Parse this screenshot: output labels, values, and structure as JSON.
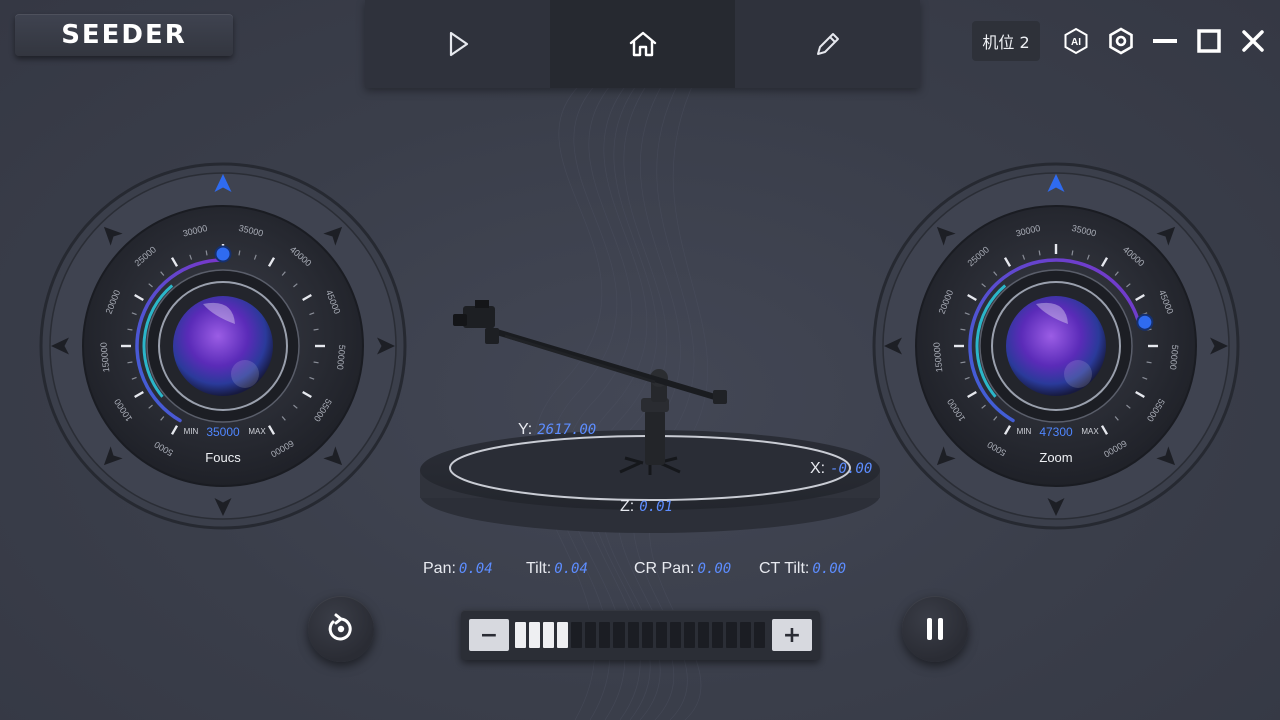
{
  "app": {
    "logo": "SEEDER"
  },
  "nav": {
    "tabs": [
      {
        "name": "play-icon"
      },
      {
        "name": "home-icon"
      },
      {
        "name": "edit-icon"
      }
    ],
    "active": 1
  },
  "window": {
    "station_label": "机位 2",
    "ai_label": "AI",
    "icons": [
      "ai-icon",
      "gear-icon",
      "minimize-icon",
      "maximize-icon",
      "close-icon"
    ]
  },
  "focus_dial": {
    "label": "Foucs",
    "value": "35000",
    "min_label": "MIN",
    "max_label": "MAX",
    "ticks": [
      "5000",
      "10000",
      "150000",
      "20000",
      "25000",
      "30000",
      "35000",
      "40000",
      "45000",
      "50000",
      "55000",
      "60000"
    ],
    "level": 0.5
  },
  "zoom_dial": {
    "label": "Zoom",
    "value": "47300",
    "min_label": "MIN",
    "max_label": "MAX",
    "ticks": [
      "5000",
      "10000",
      "150000",
      "20000",
      "25000",
      "30000",
      "35000",
      "40000",
      "45000",
      "50000",
      "55000",
      "60000"
    ],
    "level": 0.75
  },
  "coords": {
    "y_label": "Y:",
    "y_value": "2617.00",
    "x_label": "X:",
    "x_value": "-0.00",
    "z_label": "Z:",
    "z_value": "0.01"
  },
  "readouts": {
    "pan_label": "Pan:",
    "pan_value": "0.04",
    "tilt_label": "Tilt:",
    "tilt_value": "0.04",
    "crpan_label": "CR Pan:",
    "crpan_value": "0.00",
    "cttilt_label": "CT Tilt:",
    "cttilt_value": "0.00"
  },
  "speed": {
    "minus_label": "−",
    "plus_label": "+",
    "segments": 18,
    "active_segments": 4
  },
  "controls": {
    "left_button": "reset-icon",
    "right_button": "pause-icon"
  },
  "colors": {
    "accent": "#3f7bff",
    "value_blue": "#5d8dff",
    "teal": "#2bb6c9",
    "purple": "#7a35c9"
  }
}
